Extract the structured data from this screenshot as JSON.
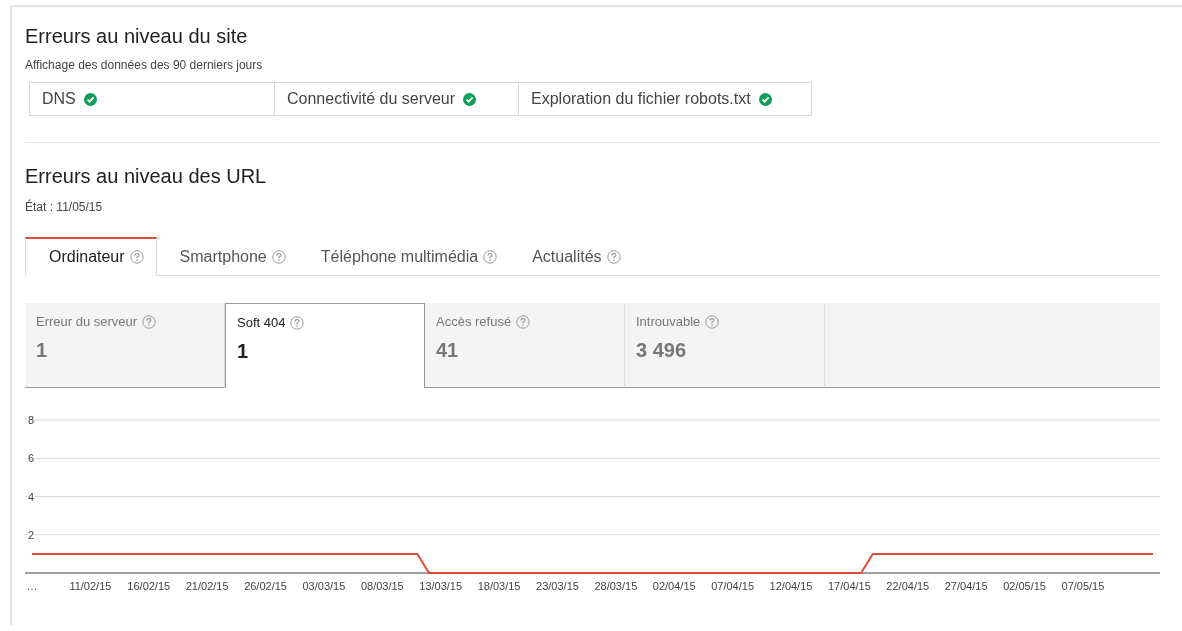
{
  "site_errors": {
    "title": "Erreurs au niveau du site",
    "subtitle": "Affichage des données des 90 derniers jours",
    "checks": [
      {
        "label": "DNS",
        "ok": true
      },
      {
        "label": "Connectivité du serveur",
        "ok": true
      },
      {
        "label": "Exploration du fichier robots.txt",
        "ok": true
      }
    ]
  },
  "url_errors": {
    "title": "Erreurs au niveau des URL",
    "status": "État : 11/05/15",
    "tabs": [
      {
        "label": "Ordinateur",
        "selected": true
      },
      {
        "label": "Smartphone",
        "selected": false
      },
      {
        "label": "Téléphone multimédia",
        "selected": false
      },
      {
        "label": "Actualités",
        "selected": false
      }
    ],
    "metrics": [
      {
        "label": "Erreur du serveur",
        "value": "1",
        "selected": false
      },
      {
        "label": "Soft 404",
        "value": "1",
        "selected": true
      },
      {
        "label": "Accès refusé",
        "value": "41",
        "selected": false
      },
      {
        "label": "Introuvable",
        "value": "3 496",
        "selected": false
      }
    ],
    "chart_data": {
      "type": "line",
      "categories": [
        "…",
        null,
        null,
        null,
        null,
        "11/02/15",
        null,
        null,
        null,
        null,
        "16/02/15",
        null,
        null,
        null,
        null,
        "21/02/15",
        null,
        null,
        null,
        null,
        "26/02/15",
        null,
        null,
        null,
        null,
        "03/03/15",
        null,
        null,
        null,
        null,
        "08/03/15",
        null,
        null,
        null,
        null,
        "13/03/15",
        null,
        null,
        null,
        null,
        "18/03/15",
        null,
        null,
        null,
        null,
        "23/03/15",
        null,
        null,
        null,
        null,
        "28/03/15",
        null,
        null,
        null,
        null,
        "02/04/15",
        null,
        null,
        null,
        null,
        "07/04/15",
        null,
        null,
        null,
        null,
        "12/04/15",
        null,
        null,
        null,
        null,
        "17/04/15",
        null,
        null,
        null,
        null,
        "22/04/15",
        null,
        null,
        null,
        null,
        "27/04/15",
        null,
        null,
        null,
        null,
        "02/05/15",
        null,
        null,
        null,
        null,
        "07/05/15",
        null,
        null,
        null,
        null,
        null,
        null
      ],
      "series": [
        {
          "color": "#dd4b39",
          "values": [
            1,
            1,
            1,
            1,
            1,
            1,
            1,
            1,
            1,
            1,
            1,
            1,
            1,
            1,
            1,
            1,
            1,
            1,
            1,
            1,
            1,
            1,
            1,
            1,
            1,
            1,
            1,
            1,
            1,
            1,
            1,
            1,
            1,
            1,
            0,
            0,
            0,
            0,
            0,
            0,
            0,
            0,
            0,
            0,
            0,
            0,
            0,
            0,
            0,
            0,
            0,
            0,
            0,
            0,
            0,
            0,
            0,
            0,
            0,
            0,
            0,
            0,
            0,
            0,
            0,
            0,
            0,
            0,
            0,
            0,
            0,
            0,
            1,
            1,
            1,
            1,
            1,
            1,
            1,
            1,
            1,
            1,
            1,
            1,
            1,
            1,
            1,
            1,
            1,
            1,
            1,
            1,
            1,
            1,
            1,
            1,
            1
          ]
        }
      ],
      "ylim": [
        0,
        8
      ],
      "yticks": [
        2,
        4,
        6,
        8
      ],
      "grid": true
    }
  }
}
